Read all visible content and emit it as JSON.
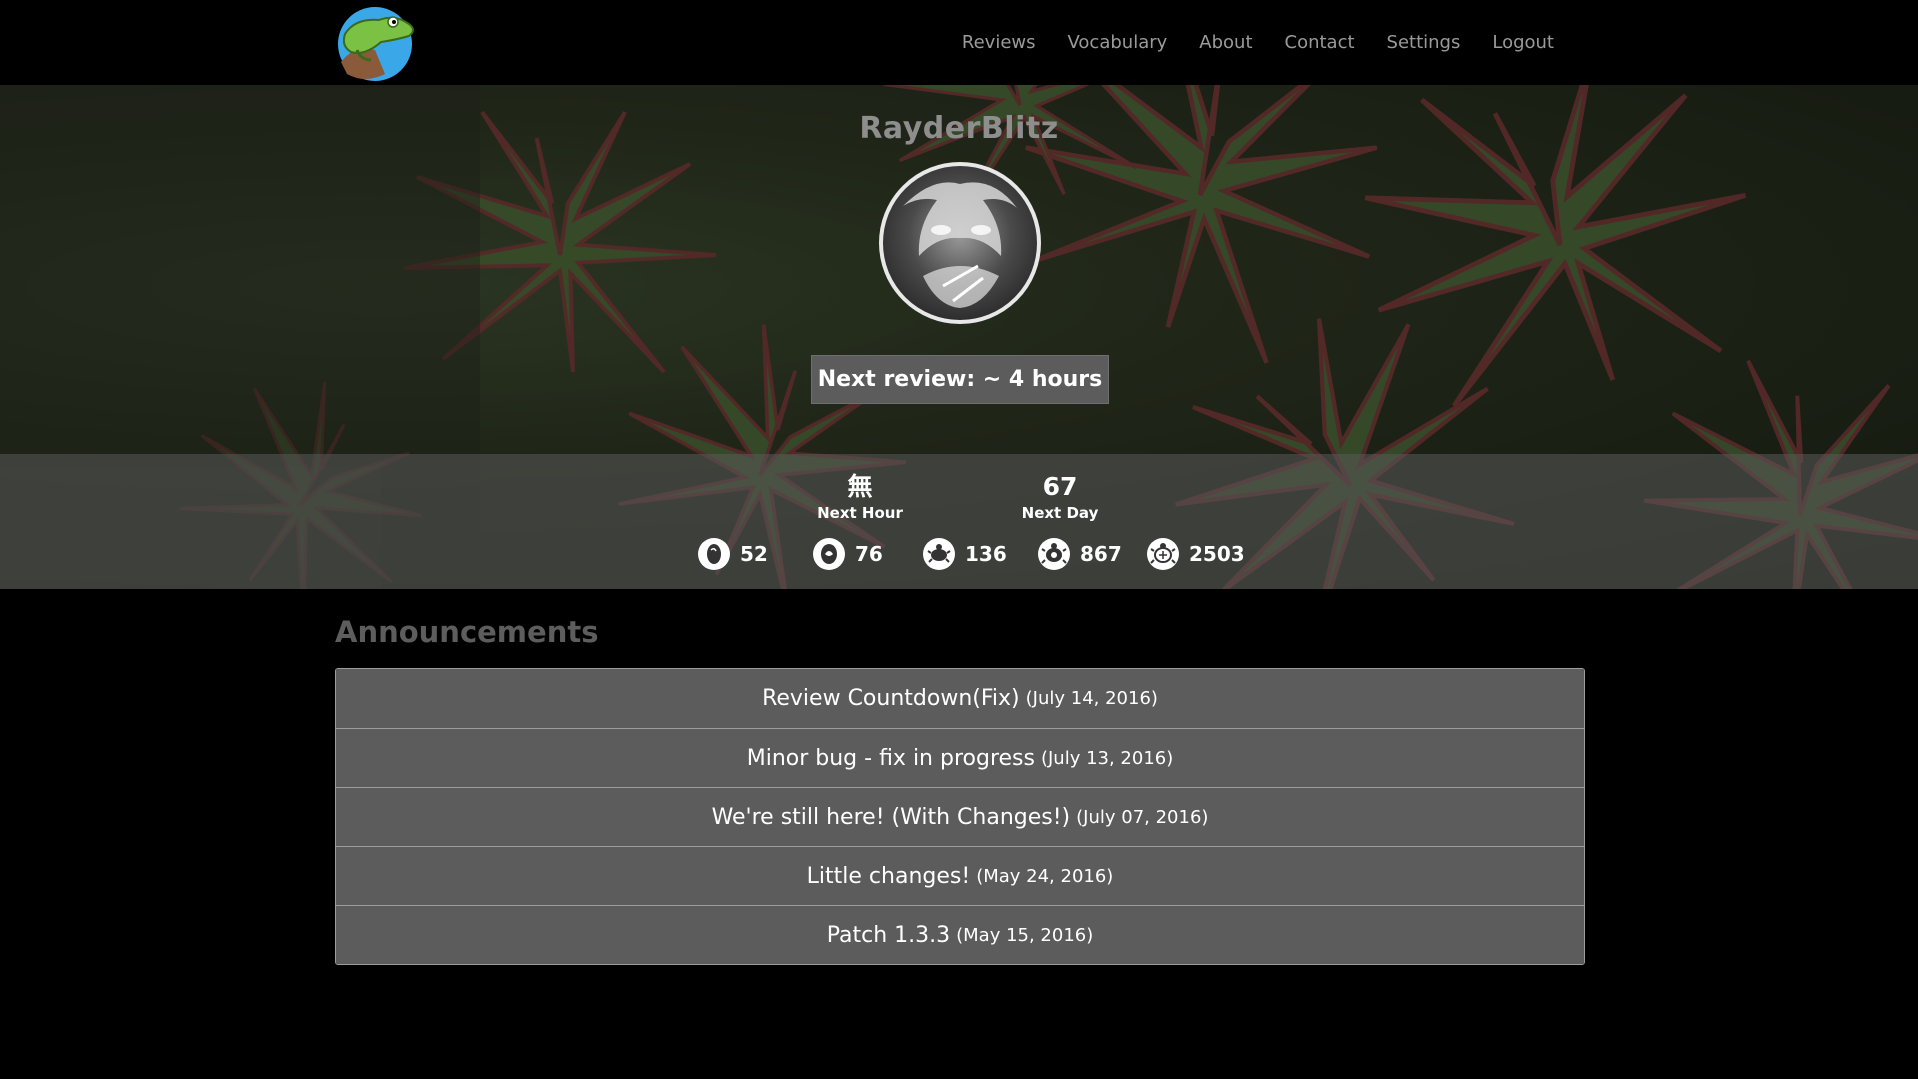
{
  "nav": {
    "logo": "frog-logo",
    "links": [
      "Reviews",
      "Vocabulary",
      "About",
      "Contact",
      "Settings",
      "Logout"
    ]
  },
  "profile": {
    "username": "RayderBlitz",
    "next_review": "Next review: ~ 4 hours"
  },
  "forecast": {
    "next_hour": {
      "value": "無",
      "label": "Next Hour"
    },
    "next_day": {
      "value": "67",
      "label": "Next Day"
    }
  },
  "srs_levels": [
    {
      "icon": "apprentice-icon",
      "count": "52"
    },
    {
      "icon": "guru-icon",
      "count": "76"
    },
    {
      "icon": "master-icon",
      "count": "136"
    },
    {
      "icon": "enlightened-icon",
      "count": "867"
    },
    {
      "icon": "burned-icon",
      "count": "2503"
    }
  ],
  "announcements": {
    "title": "Announcements",
    "items": [
      {
        "title": "Review Countdown(Fix)",
        "date": "(July 14, 2016)"
      },
      {
        "title": "Minor bug - fix in progress",
        "date": "(July 13, 2016)"
      },
      {
        "title": "We're still here! (With Changes!)",
        "date": "(July 07, 2016)"
      },
      {
        "title": "Little changes!",
        "date": "(May 24, 2016)"
      },
      {
        "title": "Patch 1.3.3",
        "date": "(May 15, 2016)"
      }
    ]
  },
  "colors": {
    "background": "#000000",
    "nav_link": "#9a9a9a",
    "panel": "#5c5c5c",
    "border": "#9d9d9d",
    "heading_muted": "#5d5d5d"
  }
}
